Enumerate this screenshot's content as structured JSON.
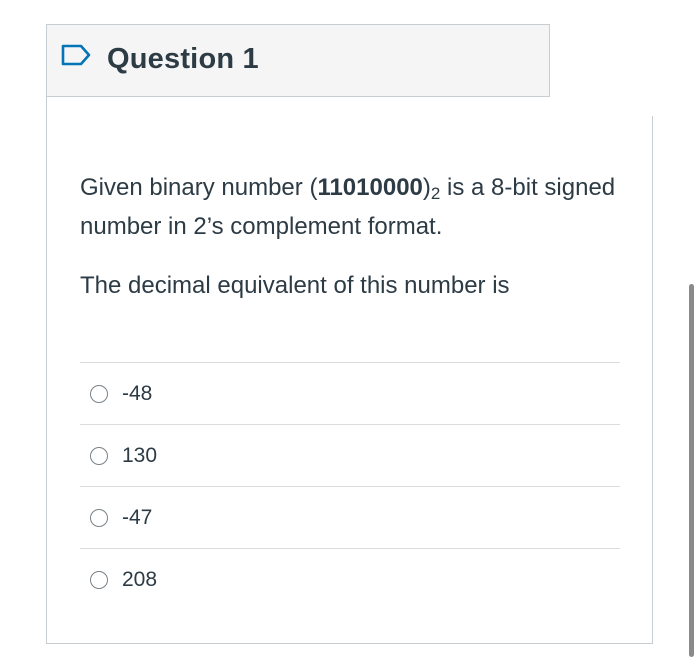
{
  "question": {
    "title": "Question 1",
    "prompt_part1": "Given binary number (",
    "binary_value": "11010000",
    "prompt_part2": ")",
    "subscript": "2",
    "prompt_part3": " is a 8-bit signed number in 2’s complement format.",
    "prompt_line2": "The decimal equivalent of this number is"
  },
  "answers": [
    {
      "label": "-48"
    },
    {
      "label": "130"
    },
    {
      "label": "-47"
    },
    {
      "label": "208"
    }
  ],
  "colors": {
    "accent": "#2d3b45",
    "border": "#c7cdd1",
    "header_bg": "#f5f5f5",
    "flag": "#0374b5"
  },
  "icons": {
    "flag": "flag-icon"
  }
}
